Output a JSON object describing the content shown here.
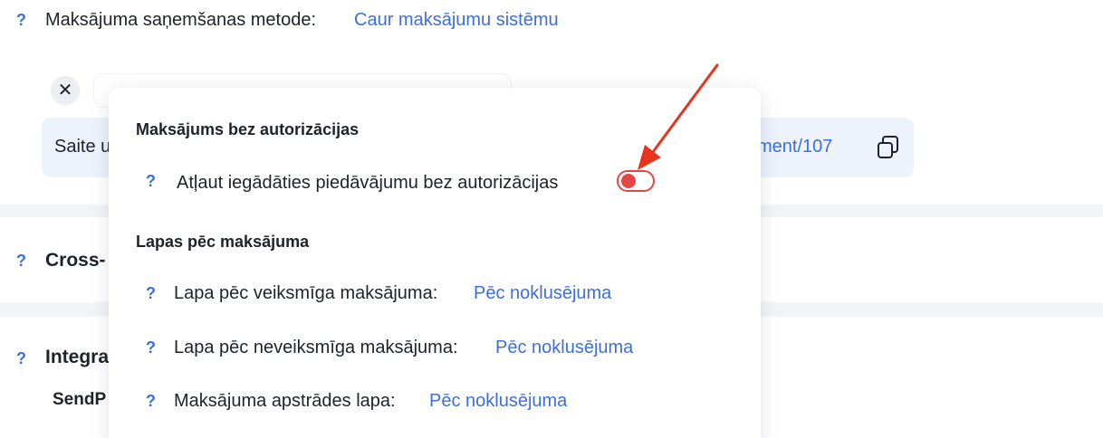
{
  "top": {
    "method_label": "Maksājuma saņemšanas metode:",
    "method_value": "Caur maksājumu sistēmu",
    "close_glyph": "✕",
    "link_box": {
      "label_prefix": "Saite u",
      "url_suffix": "yment/107"
    }
  },
  "sections": {
    "cross_title": "Cross-",
    "integr_title": "Integra",
    "integr_item": "SendP"
  },
  "help_glyph": "?",
  "popup": {
    "section1_title": "Maksājums bez autorizācijas",
    "allow_label": "Atļaut iegādāties piedāvājumu bez autorizācijas",
    "allow_toggle_on": false,
    "section2_title": "Lapas pēc maksājuma",
    "rows": [
      {
        "label": "Lapa pēc veiksmīga maksājuma:",
        "value": "Pēc noklusējuma"
      },
      {
        "label": "Lapa pēc neveiksmīga maksājuma:",
        "value": "Pēc noklusējuma"
      },
      {
        "label": "Maksājuma apstrādes lapa:",
        "value": "Pēc noklusējuma"
      }
    ]
  },
  "colors": {
    "accent": "#3b6fe0",
    "toggle_red": "#e64545",
    "annotation_arrow": "#e8341c"
  },
  "icons": [
    "help-icon",
    "close-icon",
    "copy-icon",
    "annotation-arrow"
  ]
}
